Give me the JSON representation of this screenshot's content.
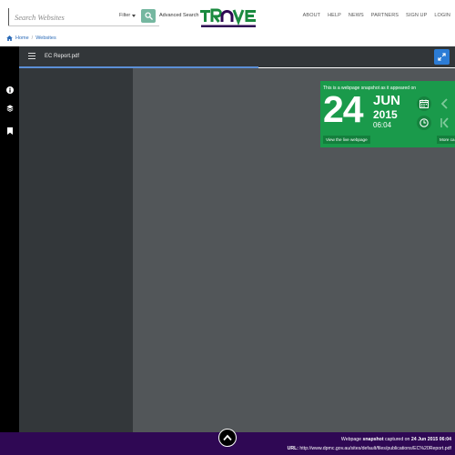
{
  "header": {
    "search_placeholder": "Search Websites",
    "filter_label": "Filter",
    "advanced_search": "Advanced Search",
    "logo_text": "TROVE",
    "nav": [
      "ABOUT",
      "HELP",
      "NEWS",
      "PARTNERS",
      "SIGN UP",
      "LOGIN"
    ],
    "colors": {
      "search_button": "#75b7a0",
      "logo_green": "#1a8a3f",
      "logo_purple": "#2f0854"
    }
  },
  "breadcrumb": {
    "home": "Home",
    "separator": "/",
    "current": "Websites"
  },
  "viewer": {
    "title": "EC Report.pdf",
    "rail_icons": [
      "info-icon",
      "layers-icon",
      "bookmark-icon"
    ],
    "load_progress": 0.55,
    "colors": {
      "toolbar": "#323639",
      "expand_button": "#2c7cd5"
    }
  },
  "snapshot": {
    "intro": "This is a webpage snapshot as it appeared on",
    "day": "24",
    "month": "JUN",
    "year": "2015",
    "time": "06:04",
    "live_button": "View the live webpage",
    "more_button": "More ca",
    "icons": [
      "calendar-icon",
      "chevron-left-icon",
      "clock-icon",
      "skip-first-icon"
    ],
    "color": "#1a9a4b"
  },
  "footer": {
    "prefix": "Webpage",
    "emphasis": "snapshot",
    "middle": "captured on",
    "date": "24 Jun 2015 06:04",
    "url_label": "URL:",
    "url": "http://www.dpmc.gov.au/sites/default/files/publications/EC%20Report.pdf",
    "color": "#2f0854"
  }
}
